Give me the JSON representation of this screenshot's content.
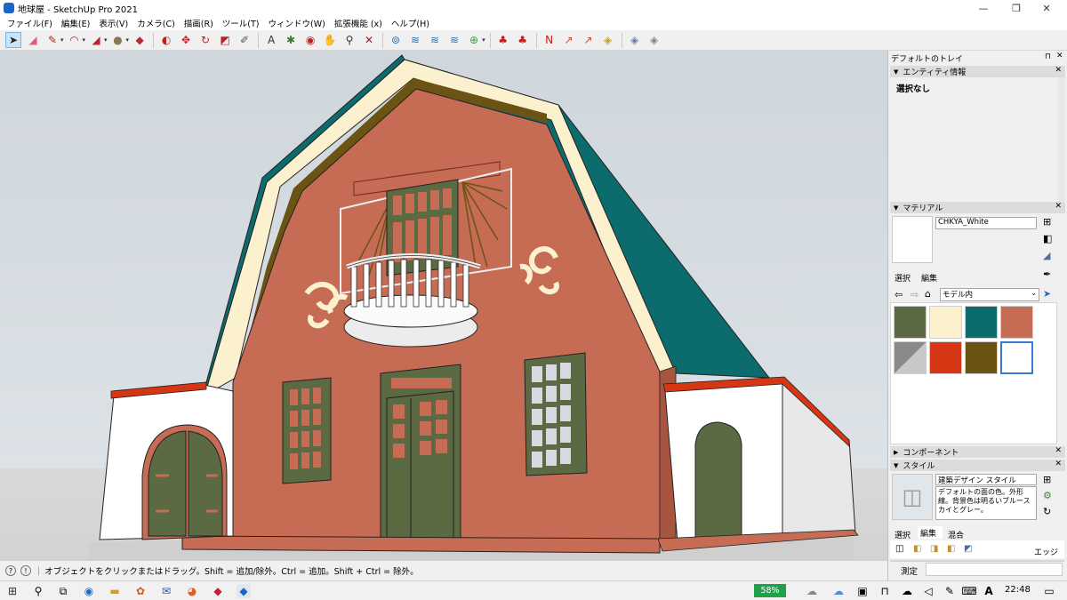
{
  "window": {
    "title": "地球屋 - SketchUp Pro 2021",
    "minimize": "—",
    "maximize": "❐",
    "close": "✕"
  },
  "menu": [
    "ファイル(F)",
    "編集(E)",
    "表示(V)",
    "カメラ(C)",
    "描画(R)",
    "ツール(T)",
    "ウィンドウ(W)",
    "拡張機能 (x)",
    "ヘルプ(H)"
  ],
  "toolbar": [
    {
      "name": "select-tool",
      "glyph": "➤",
      "color": "#222"
    },
    {
      "name": "eraser-tool",
      "glyph": "◢",
      "color": "#e05a7a"
    },
    {
      "name": "line-tool",
      "glyph": "✎",
      "color": "#b02020"
    },
    {
      "name": "arc-tool",
      "glyph": "◠",
      "color": "#c02030"
    },
    {
      "name": "shape-tool",
      "glyph": "◢",
      "color": "#c02030"
    },
    {
      "name": "paint-tool",
      "glyph": "●",
      "color": "#8a7a50"
    },
    {
      "name": "push-pull-tool",
      "glyph": "◆",
      "color": "#b03030"
    },
    {
      "name": "follow-me-tool",
      "glyph": "◐",
      "color": "#c02020"
    },
    {
      "name": "move-tool",
      "glyph": "✥",
      "color": "#c02020"
    },
    {
      "name": "rotate-tool",
      "glyph": "↻",
      "color": "#c02020"
    },
    {
      "name": "scale-tool",
      "glyph": "◩",
      "color": "#c02020"
    },
    {
      "name": "tape-measure-tool",
      "glyph": "✐",
      "color": "#555"
    },
    {
      "name": "text-tool",
      "glyph": "A",
      "color": "#333"
    },
    {
      "name": "axes-tool",
      "glyph": "✱",
      "color": "#3a7a2a"
    },
    {
      "name": "orbit-tool",
      "glyph": "◉",
      "color": "#c02020"
    },
    {
      "name": "pan-tool",
      "glyph": "✋",
      "color": "#b07030"
    },
    {
      "name": "zoom-tool",
      "glyph": "⚲",
      "color": "#333"
    },
    {
      "name": "zoom-extents-tool",
      "glyph": "✕",
      "color": "#a02020"
    },
    {
      "name": "warehouse-icon",
      "glyph": "⊚",
      "color": "#2a70b0"
    },
    {
      "name": "components-icon",
      "glyph": "≋",
      "color": "#2a70b0"
    },
    {
      "name": "materials-icon",
      "glyph": "≋",
      "color": "#2a70b0"
    },
    {
      "name": "extensions-icon",
      "glyph": "≋",
      "color": "#2a70b0"
    },
    {
      "name": "account-icon",
      "glyph": "⊕",
      "color": "#3a9a3a"
    },
    {
      "name": "sandbox-icon",
      "glyph": "♣",
      "color": "#c02020"
    },
    {
      "name": "section-icon",
      "glyph": "♣",
      "color": "#c02020"
    },
    {
      "name": "north-icon",
      "glyph": "N",
      "color": "#c02020"
    },
    {
      "name": "position-camera-icon",
      "glyph": "↗",
      "color": "#c05020"
    },
    {
      "name": "walk-icon",
      "glyph": "↗",
      "color": "#c05020"
    },
    {
      "name": "group-icon",
      "glyph": "◈",
      "color": "#c0a030"
    },
    {
      "name": "component-icon",
      "glyph": "◈",
      "color": "#6a7aa0"
    },
    {
      "name": "solid-icon",
      "glyph": "◈",
      "color": "#7a8a6a"
    }
  ],
  "tray": {
    "title": "デフォルトのトレイ",
    "pin": "⊓",
    "entity_info": {
      "header": "エンティティ情報",
      "content": "選択なし"
    },
    "materials": {
      "header": "マテリアル",
      "current_name": "CHKYA_White",
      "tabs": [
        "選択",
        "編集"
      ],
      "library": "モデル内",
      "swatch_colors": [
        "#5b6a43",
        "#fcf1cf",
        "#0b6b6d",
        "#c66b54",
        "#8a8a8a",
        "#d63614",
        "#6b5314",
        "#ffffff"
      ]
    },
    "components": {
      "header": "コンポーネント"
    },
    "styles": {
      "header": "スタイル",
      "style_name": "建築デザイン スタイル",
      "description": "デフォルトの面の色。外形線。背景色は明るいブルースカイとグレー。",
      "tabs": [
        "選択",
        "編集",
        "混合"
      ],
      "edge_label": "エッジ"
    }
  },
  "status": {
    "message": "オブジェクトをクリックまたはドラッグ。Shift = 追加/除外。Ctrl = 追加。Shift + Ctrl = 除外。",
    "measure_label": "測定"
  },
  "taskbar": {
    "battery": "58%",
    "clock": "22:48"
  }
}
